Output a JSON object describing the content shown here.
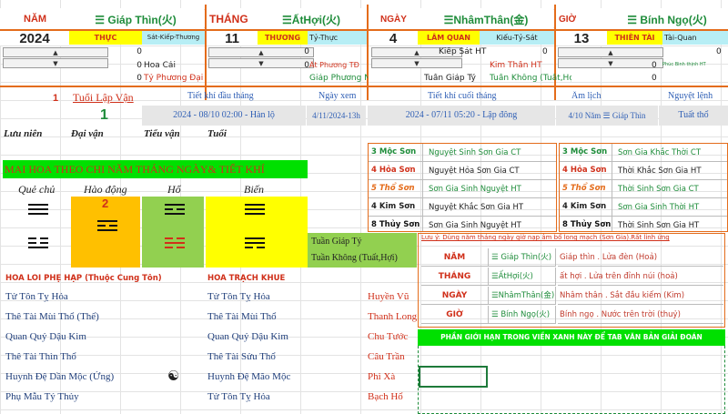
{
  "row1": {
    "nam_label": "NĂM",
    "nam_can_chi": "☰ Giáp Thìn(火)",
    "thang_label": "THÁNG",
    "thang_can_chi": "☰ẤtHợi(火)",
    "ngay_label": "NGÀY",
    "ngay_can_chi": "☰NhâmThân(金)",
    "gio_label": "GIỜ",
    "gio_can_chi": "☰ Bính Ngọ(火)"
  },
  "row2": {
    "nam_value": "2024",
    "nam_tag1": "THỰC",
    "nam_tag2": "Sát-Kiếp-Thương",
    "thang_value": "11",
    "thang_tag1": "THƯƠNG",
    "thang_tag2": "Tỷ-Thực",
    "ngay_value": "4",
    "ngay_tag1": "LÂM QUAN",
    "ngay_tag2": "Kiếu-Tỷ-Sát",
    "gio_value": "13",
    "gio_tag1": "THIÊN TÀI",
    "gio_tag2": "Tài-Quan"
  },
  "row3": {
    "z1": "0",
    "z2": "0",
    "ngay_text": "Kiếp Sát HT",
    "z3": "0",
    "z4": "0"
  },
  "row4": {
    "nam_text": "Hoa Cái",
    "z1": "0",
    "thang_text": "Ất Phương TĐ",
    "z2": "0",
    "gio_text": "Kim Thần HT",
    "z3": "0",
    "gio_tag": "Phúc Bình thịnh HT"
  },
  "row5": {
    "nam_text": "Tỷ Phương Đại Sát",
    "z1": "0",
    "thang_text": "Giáp Phương NĐ",
    "ngay_text": "Tuần Giáp Tý",
    "gio_text": "Tuần Không (Tuất,Hợi)",
    "z2": "0"
  },
  "row6": {
    "num": "1",
    "tuoi_lap_van": "Tuổi Lập Vận",
    "tiet_khi_dau": "Tiết khí đầu tháng",
    "ngay_xem": "Ngày xem",
    "tiet_khi_cuoi": "Tiết khí cuối tháng",
    "am_lich": "Âm lịch",
    "nguyet_lenh": "Nguyệt lệnh"
  },
  "row7": {
    "big_one": "1",
    "tk_dau_val": "2024 - 08/10 02:00 - Hàn lộ",
    "ngay_xem_val": "4/11/2024-13h",
    "tk_cuoi_val": "2024 - 07/11 05:20 - Lập đông",
    "am_lich_val": "4/10 Năm ☰ Giáp Thìn",
    "nguyet_lenh_val": "Tuất thổ"
  },
  "row8": {
    "luu_nien": "Lưu niên",
    "dai_van": "Đại vận",
    "tieu_van": "Tiểu vận",
    "tuoi": "Tuổi"
  },
  "son": {
    "left": [
      {
        "name": "3 Mộc Sơn",
        "val": "Nguyệt Sinh Sơn Gia CT"
      },
      {
        "name": "4 Hỏa Sơn",
        "val": "Nguyệt Hỏa Sơn Gia CT"
      },
      {
        "name": "5 Thổ Sơn",
        "val": "Sơn Gia Sinh Nguyệt HT"
      },
      {
        "name": "4 Kim Sơn",
        "val": "Nguyệt Khắc Sơn Gia HT"
      },
      {
        "name": "8 Thủy Sơn",
        "val": "Sơn Gia Sinh Nguyệt HT"
      }
    ],
    "right": [
      {
        "name": "3 Mộc Sơn",
        "val": "Sơn Gia Khắc Thời CT"
      },
      {
        "name": "4 Hỏa Sơn",
        "val": "Thời Khắc Sơn Gia HT"
      },
      {
        "name": "5 Thổ Sơn",
        "val": "Thời Sinh Sơn Gia CT"
      },
      {
        "name": "4 Kim Sơn",
        "val": "Sơn Gia Sinh Thời HT"
      },
      {
        "name": "8 Thủy Sơn",
        "val": "Thời Sinh Sơn Gia HT"
      }
    ]
  },
  "mai_hoa": {
    "title": "MAI HOA THEO CHI NĂM THÁNG NGÀY& TIẾT KHÍ",
    "que_chu": "Quẻ chủ",
    "hao_dong": "Hào động",
    "ho": "Hổ",
    "bien": "Biến",
    "hao_num": "2"
  },
  "tuan": {
    "giap_ty": "Tuần Giáp Tý",
    "khong": "Tuần Không (Tuất,Hợi)"
  },
  "napam": {
    "note": "Lưu ý: Dùng năm tháng ngày giờ nạp âm bổ long mạch (Sơn Gia).Rất linh ứng",
    "rows": [
      {
        "label": "NĂM",
        "cc": "☰ Giáp Thìn(火)",
        "desc": "Giáp thìn . Lửa đèn (Hoả)"
      },
      {
        "label": "THÁNG",
        "cc": "☰ẤtHợi(火)",
        "desc": "ất hợi . Lửa trên đỉnh núi (hoả)"
      },
      {
        "label": "NGÀY",
        "cc": "☰NhâmThân(金)",
        "desc": "Nhâm thân . Sắt đầu kiếm (Kim)"
      },
      {
        "label": "GIỜ",
        "cc": "☰ Bính Ngọ(火)",
        "desc": "Bính ngọ . Nước trên trời (thuỷ)"
      }
    ],
    "banner": "PHẦN GIỚI HẠN TRONG VIỀN XANH NÀY ĐỂ TAB VĂN BẢN GIẢI ĐOÁN"
  },
  "hoa_loi": {
    "title_left": "HÒA LÔI PHỆ HẠP (Thuộc Cung Tốn)",
    "title_right": "HÒA TRẠCH KHUÊ",
    "rows": [
      {
        "left": "Tử Tôn Tỵ Hỏa",
        "right": "Tử Tôn Tỵ Hỏa",
        "than": "Huyền Vũ"
      },
      {
        "left": "Thê Tài Mùi Thổ (Thế)",
        "right": "Thê Tài Mùi Thổ",
        "than": "Thanh Long"
      },
      {
        "left": "Quan Quỷ Dậu Kim",
        "right": "Quan Quỷ Dậu Kim",
        "than": "Chu Tước"
      },
      {
        "left": "Thê Tài Thìn Thổ",
        "right": "Thê Tài Sửu Thổ",
        "than": "Câu Trần"
      },
      {
        "left": "Huynh Đệ Dần Mộc (Ứng)",
        "right": "Huynh Đệ Mão Mộc",
        "than": "Phi Xà"
      },
      {
        "left": "Phụ Mẫu Tý Thủy",
        "right": "Tử Tôn Tỵ Hỏa",
        "than": "Bạch Hổ"
      }
    ]
  },
  "colors": {
    "red": "#d0301a",
    "green": "#1e8c3a",
    "yellow": "#ffff00",
    "orange": "#ffc000",
    "lime": "#92d050",
    "bright_green": "#00e000"
  }
}
